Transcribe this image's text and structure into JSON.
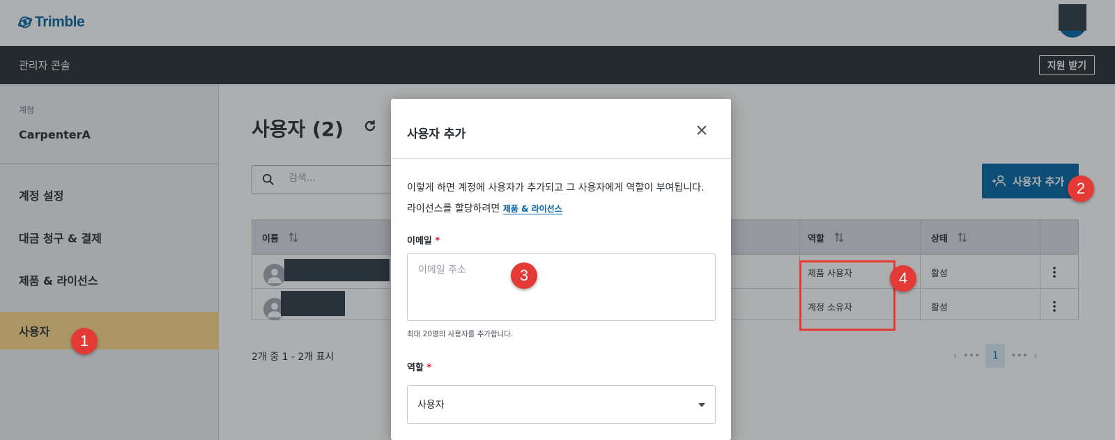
{
  "app": {
    "logo_text": "Trimble",
    "console_title": "관리자 콘솔",
    "support_label": "지원 받기"
  },
  "sidebar": {
    "account_label": "계정",
    "account_name": "CarpenterA",
    "items": [
      {
        "label": "계정 설정",
        "active": false
      },
      {
        "label": "대금 청구 & 결제",
        "active": false
      },
      {
        "label": "제품 & 라이선스",
        "active": false
      },
      {
        "label": "사용자",
        "active": true
      }
    ]
  },
  "main": {
    "title": "사용자 (2)",
    "search_placeholder": "검색...",
    "add_user_label": "사용자 추가",
    "table": {
      "headers": {
        "name": "이름",
        "role": "역할",
        "status": "상태"
      },
      "rows": [
        {
          "role": "제품 사용자",
          "status": "활성"
        },
        {
          "role": "계정 소유자",
          "status": "활성"
        }
      ]
    },
    "footer_count": "2개 중 1 - 2개 표시",
    "pager": {
      "current_page": "1"
    }
  },
  "modal": {
    "title": "사용자 추가",
    "description": "이렇게 하면 계정에 사용자가 추가되고 그 사용자에게 역할이 부여됩니다. 라이선스를 할당하려면",
    "link_text": "제품 & 라이선스",
    "email_label": "이메일",
    "email_placeholder": "이메일 주소",
    "email_hint": "최대 20명의 사용자를 추가합니다.",
    "role_label": "역할",
    "role_value": "사용자",
    "required_mark": "*"
  },
  "annotations": [
    "1",
    "2",
    "3",
    "4"
  ],
  "colors": {
    "brand": "#0063a3",
    "dark_bar": "#252a2e",
    "active_nav": "#ffd88a",
    "annotation": "#e53935"
  }
}
